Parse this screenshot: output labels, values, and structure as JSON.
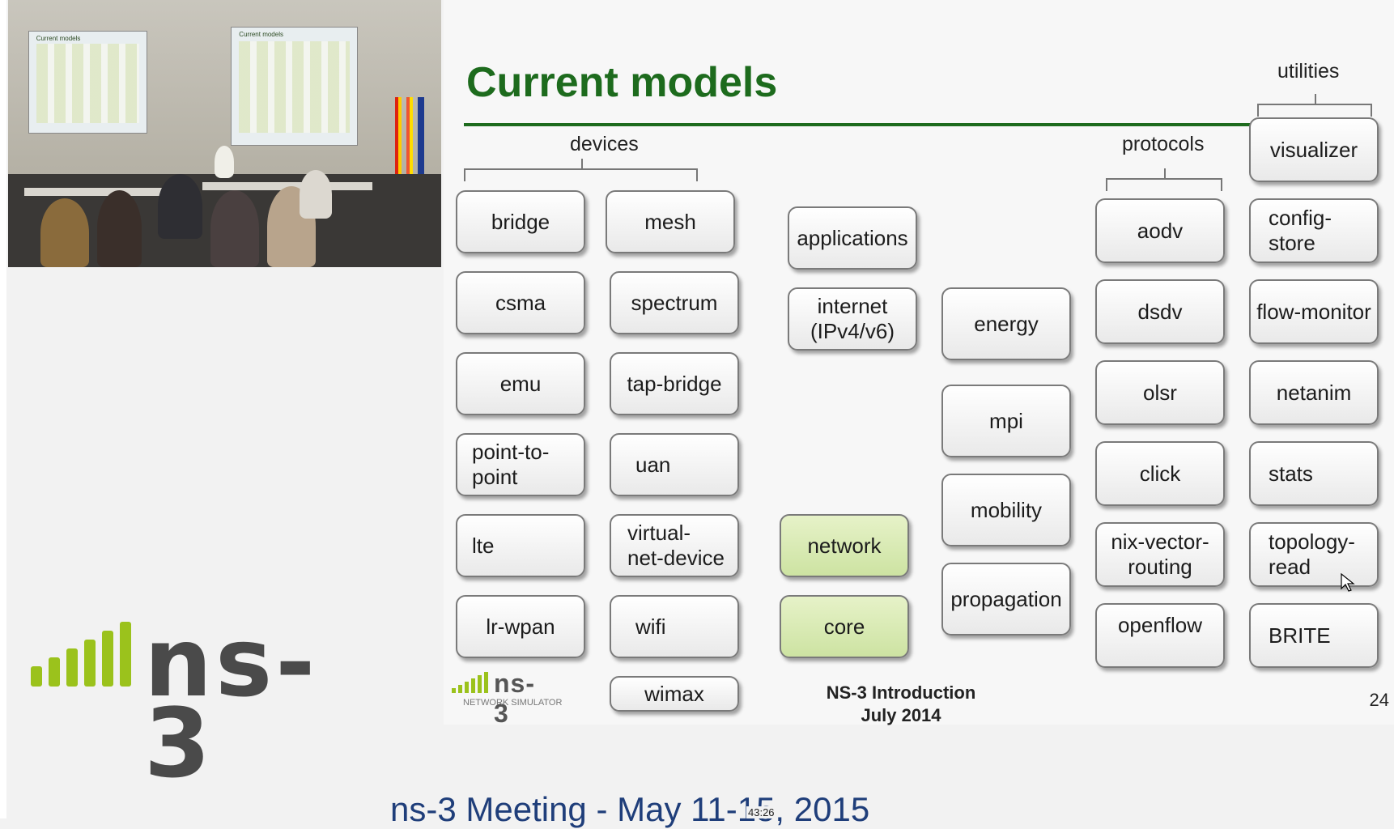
{
  "camera": {
    "left_screen_title": "Current models",
    "right_screen_title": "Current models"
  },
  "slide": {
    "title": "Current models",
    "groups": {
      "utilities": "utilities",
      "devices": "devices",
      "protocols": "protocols"
    },
    "devices_col1": [
      "bridge",
      "csma",
      "emu",
      "point-to-\npoint",
      "lte",
      "lr-wpan"
    ],
    "devices_col2": [
      "mesh",
      "spectrum",
      "tap-bridge",
      "uan",
      "virtual-\nnet-device",
      "wifi",
      "wimax"
    ],
    "center_col1": [
      "applications",
      "internet\n(IPv4/v6)",
      "network",
      "core"
    ],
    "center_col2": [
      "energy",
      "mpi",
      "mobility",
      "propagation"
    ],
    "protocols": [
      "aodv",
      "dsdv",
      "olsr",
      "click",
      "nix-vector-\nrouting",
      "openflow"
    ],
    "utilities": [
      "visualizer",
      "config-\nstore",
      "flow-monitor",
      "netanim",
      "stats",
      "topology-\nread",
      "BRITE"
    ],
    "footer_line1": "NS-3 Introduction",
    "footer_line2": "July 2014",
    "page_number": "24",
    "logo_text": "ns-3",
    "logo_subtext": "NETWORK SIMULATOR"
  },
  "big_logo": "ns-3",
  "caption": "ns-3 Meeting - May 11-15, 2015",
  "timestamp": "43:26",
  "colors": {
    "title_green": "#1d6b1d",
    "highlight_box": "#d6e9ad",
    "logo_green": "#9bc21c",
    "caption_blue": "#1f3e7a"
  }
}
